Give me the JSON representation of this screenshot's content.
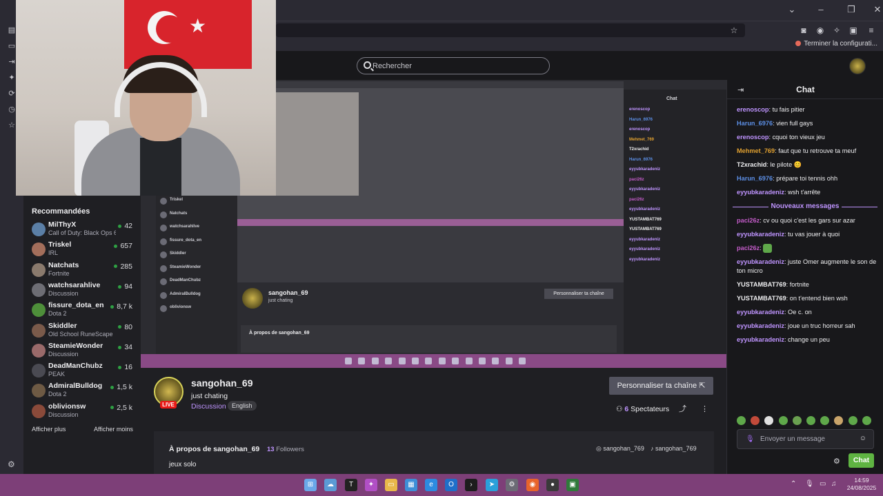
{
  "browser": {
    "bookmark_label": "Terminer la configurati..."
  },
  "search": {
    "placeholder": "Rechercher"
  },
  "sidebar": {
    "heading": "Recommandées",
    "show_more": "Afficher plus",
    "show_less": "Afficher moins",
    "channels": [
      {
        "name": "MilThyX",
        "game": "Call of Duty: Black Ops 6",
        "viewers": "42",
        "color": "#5b7fa6"
      },
      {
        "name": "Triskel",
        "game": "IRL",
        "viewers": "657",
        "color": "#a36e5b"
      },
      {
        "name": "Natchats",
        "game": "Fortnite",
        "viewers": "285",
        "color": "#8a7a6d"
      },
      {
        "name": "watchsarahlive",
        "game": "Discussion",
        "viewers": "94",
        "color": "#6d6d74"
      },
      {
        "name": "fissure_dota_en",
        "game": "Dota 2",
        "viewers": "8,7 k",
        "color": "#4e8f3a"
      },
      {
        "name": "Skiddler",
        "game": "Old School RuneScape",
        "viewers": "80",
        "color": "#7a5a4a"
      },
      {
        "name": "SteamieWonder",
        "game": "Discussion",
        "viewers": "34",
        "color": "#9a6a6a"
      },
      {
        "name": "DeadManChubz",
        "game": "PEAK",
        "viewers": "16",
        "color": "#4a4a52"
      },
      {
        "name": "AdmiralBulldog",
        "game": "Dota 2",
        "viewers": "1,5 k",
        "color": "#6e5a44"
      },
      {
        "name": "oblivionsw",
        "game": "Discussion",
        "viewers": "2,5 k",
        "color": "#8a4a3a"
      }
    ]
  },
  "stream": {
    "streamer": "sangohan_69",
    "live": "LIVE",
    "title": "just chating",
    "category": "Discussion",
    "tag": "English",
    "personalize": "Personnaliser ta chaîne",
    "viewers_count": "6",
    "viewers_label": "Spectateurs"
  },
  "about": {
    "title": "À propos de sangohan_69",
    "followers_count": "13",
    "followers_label": "Followers",
    "description": "jeux solo",
    "instagram": "sangohan_769",
    "tiktok": "sangohan_769"
  },
  "chat": {
    "title": "Chat",
    "new_messages": "Nouveaux messages",
    "input_placeholder": "Envoyer un message",
    "send": "Chat",
    "messages_before": [
      {
        "user": "erenoscop",
        "color": "#bf94ff",
        "text": ": tu fais pitier"
      },
      {
        "user": "Harun_6976",
        "color": "#5c8fe6",
        "text": ": vien full gays"
      },
      {
        "user": "erenoscop",
        "color": "#bf94ff",
        "text": ": cquoi ton vieux jeu"
      },
      {
        "user": "Mehmet_769",
        "color": "#e0a030",
        "text": ": faut que tu retrouve ta meuf"
      },
      {
        "user": "T2xrachid",
        "color": "#efeff1",
        "text": ": le pilote 😊"
      },
      {
        "user": "Harun_6976",
        "color": "#5c8fe6",
        "text": ": prépare toi tennis ohh"
      },
      {
        "user": "eyyubkaradeniz",
        "color": "#bf94ff",
        "text": ": wsh t'arrête"
      }
    ],
    "messages_after": [
      {
        "user": "paci26z",
        "color": "#c45cc9",
        "text": ": cv ou quoi c'est les gars sur azar"
      },
      {
        "user": "eyyubkaradeniz",
        "color": "#bf94ff",
        "text": ": tu vas jouer à quoi"
      },
      {
        "user": "paci26z",
        "color": "#c45cc9",
        "text": ": "
      },
      {
        "user": "eyyubkaradeniz",
        "color": "#bf94ff",
        "text": ": juste Omer augmente le son de ton micro"
      },
      {
        "user": "YUSTAMBAT769",
        "color": "#efeff1",
        "text": ": fortnite"
      },
      {
        "user": "YUSTAMBAT769",
        "color": "#efeff1",
        "text": ": on t'entend bien wsh"
      },
      {
        "user": "eyyubkaradeniz",
        "color": "#bf94ff",
        "text": ": Oe c. on"
      },
      {
        "user": "eyyubkaradeniz",
        "color": "#bf94ff",
        "text": ": joue un truc horreur sah"
      },
      {
        "user": "eyyubkaradeniz",
        "color": "#bf94ff",
        "text": ": change un peu"
      }
    ]
  },
  "inner_stream": {
    "chat_title": "Chat",
    "streamer": "sangohan_69",
    "title": "just chating",
    "personalize": "Personnaliser ta chaîne",
    "about": "À propos de sangohan_69"
  },
  "taskbar": {
    "time": "14:59",
    "date": "24/08/2025"
  }
}
